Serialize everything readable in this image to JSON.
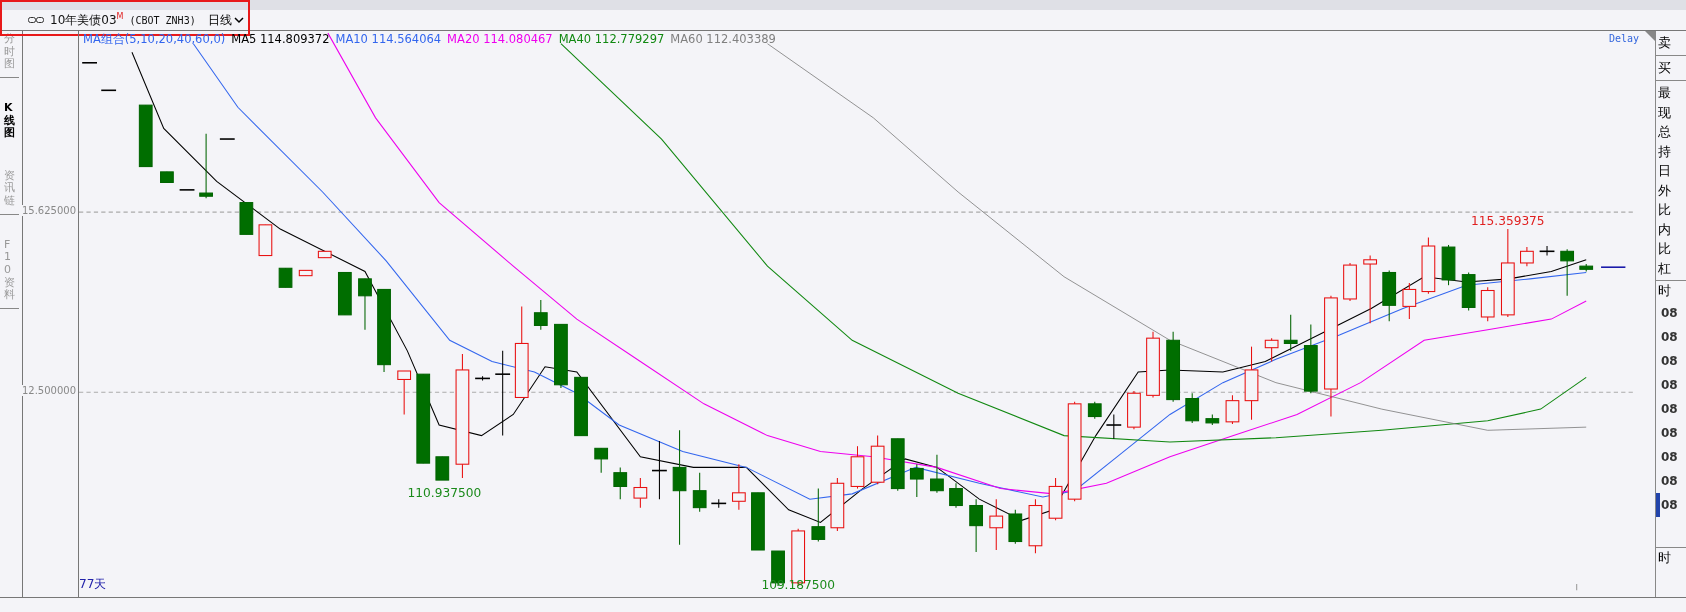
{
  "header": {
    "title": "10年美债03",
    "title_mark": "M",
    "code": "(CBOT ZNH3)",
    "period": "日线"
  },
  "side_tabs": [
    {
      "label": "分时图",
      "selected": false
    },
    {
      "label": "K线图",
      "selected": true
    },
    {
      "label": "资讯链",
      "selected": false
    },
    {
      "label": "F10资料",
      "selected": false
    }
  ],
  "ma_legend": {
    "group": "MA组合(5,10,20,40,60,0)",
    "items": [
      {
        "label": "MA5 114.809372",
        "color": "#000000"
      },
      {
        "label": "MA10 114.564064",
        "color": "#3366ee"
      },
      {
        "label": "MA20 114.080467",
        "color": "#ee00ee"
      },
      {
        "label": "MA40 112.779297",
        "color": "#118811"
      },
      {
        "label": "MA60 112.403389",
        "color": "#808080"
      }
    ]
  },
  "chart": {
    "delay": "Delay",
    "y_labels": [
      "15.625000",
      "12.500000"
    ],
    "days": "77天",
    "price_labels": [
      {
        "text": "110.937500",
        "kind": "low"
      },
      {
        "text": "109.187500",
        "kind": "low"
      },
      {
        "text": "115.359375",
        "kind": "high"
      }
    ]
  },
  "right_panel": {
    "order_rows": [
      "卖",
      "买"
    ],
    "quote_rows": [
      "最",
      "现",
      "总",
      "持",
      "日",
      "外",
      "比",
      "内",
      "比",
      "杠"
    ],
    "trade_header": "时",
    "trade_times": [
      {
        "text": "08",
        "selected": false
      },
      {
        "text": "08",
        "selected": false
      },
      {
        "text": "08",
        "selected": false
      },
      {
        "text": "08",
        "selected": false
      },
      {
        "text": "08",
        "selected": false
      },
      {
        "text": "08",
        "selected": false
      },
      {
        "text": "08",
        "selected": false
      },
      {
        "text": "08",
        "selected": false
      },
      {
        "text": "08",
        "selected": true
      }
    ],
    "trade_header_2": "时"
  }
}
